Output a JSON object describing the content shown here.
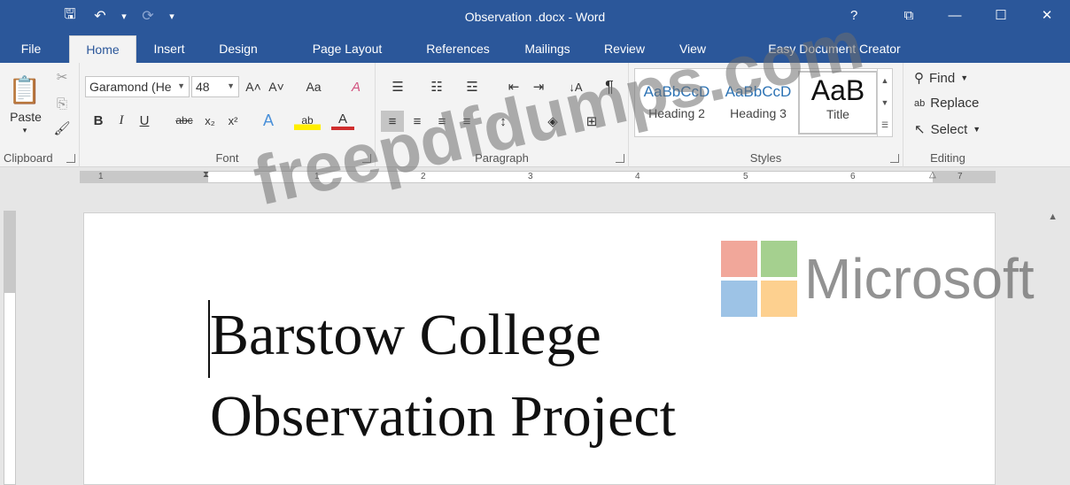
{
  "window": {
    "title": "Observation .docx   - Word",
    "help": "?",
    "controls": {
      "ribbon_display": "⧉",
      "minimize": "—",
      "maximize": "☐",
      "close": "✕"
    }
  },
  "quick_access": {
    "save": "🖫",
    "undo": "↶",
    "undo_dropdown": "▾",
    "redo": "⟳",
    "customize": "▾"
  },
  "tabs": [
    "File",
    "Home",
    "Insert",
    "Design",
    "Page Layout",
    "References",
    "Mailings",
    "Review",
    "View",
    "Easy Document Creator"
  ],
  "active_tab": "Home",
  "ribbon": {
    "clipboard": {
      "label": "Clipboard",
      "paste": "Paste",
      "paste_arrow": "▾",
      "cut": "✂",
      "copy": "⎘",
      "format_painter": "🖌"
    },
    "font": {
      "label": "Font",
      "font_name": "Garamond (He",
      "font_size": "48",
      "grow": "A˄",
      "shrink": "A˅",
      "change_case": "Aa",
      "clear_format": "A",
      "bold": "B",
      "italic": "I",
      "underline": "U",
      "strikethrough": "abc",
      "subscript": "x₂",
      "superscript": "x²",
      "text_effects": "A",
      "highlight": "ab",
      "font_color": "A"
    },
    "paragraph": {
      "label": "Paragraph",
      "bullets": "☰",
      "numbering": "☷",
      "multilevel": "☲",
      "decrease_indent": "⇤",
      "increase_indent": "⇥",
      "sort": "↓A",
      "show_marks": "¶",
      "align_left": "≡",
      "align_center": "≡",
      "align_right": "≡",
      "justify": "≡",
      "line_spacing": "↕",
      "shading": "◈",
      "borders": "⊞"
    },
    "styles": {
      "label": "Styles",
      "items": [
        {
          "preview": "AaBbCcD",
          "name": "Heading 2"
        },
        {
          "preview": "AaBbCcD",
          "name": "Heading 3"
        },
        {
          "preview": "AaB",
          "name": "Title"
        }
      ]
    },
    "editing": {
      "label": "Editing",
      "find": "Find",
      "replace": "Replace",
      "select": "Select"
    }
  },
  "ruler": {
    "numbers": [
      "1",
      "1",
      "2",
      "3",
      "4",
      "5",
      "6",
      "7"
    ],
    "tab_selector": "L"
  },
  "document": {
    "lines": [
      "Barstow College",
      "Observation Project"
    ]
  },
  "overlay": {
    "watermark": "freepdfdumps.com",
    "brand": "Microsoft"
  },
  "colors": {
    "accent": "#2b579a",
    "ms_red": "#f1a79a",
    "ms_green": "#a5d08f",
    "ms_blue": "#9dc3e6",
    "ms_yellow": "#fdd08f"
  }
}
